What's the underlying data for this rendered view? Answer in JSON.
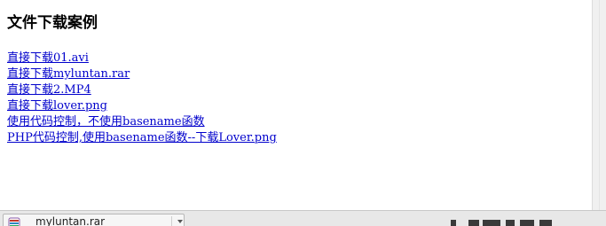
{
  "page": {
    "title": "文件下载案例",
    "links": [
      "直接下载01.avi",
      "直接下载myluntan.rar",
      "直接下载2.MP4",
      "直接下载lover.png",
      "使用代码控制，不使用basename函数",
      "PHP代码控制,使用basename函数--下载Lover.png"
    ]
  },
  "download_bar": {
    "item": {
      "file_name": "myluntan.rar",
      "icon": "rar-archive-icon"
    },
    "menu_icon": "chevron-down-icon"
  },
  "colors": {
    "link": "#0000cc",
    "download_bar_bg": "#e8e8e8"
  }
}
